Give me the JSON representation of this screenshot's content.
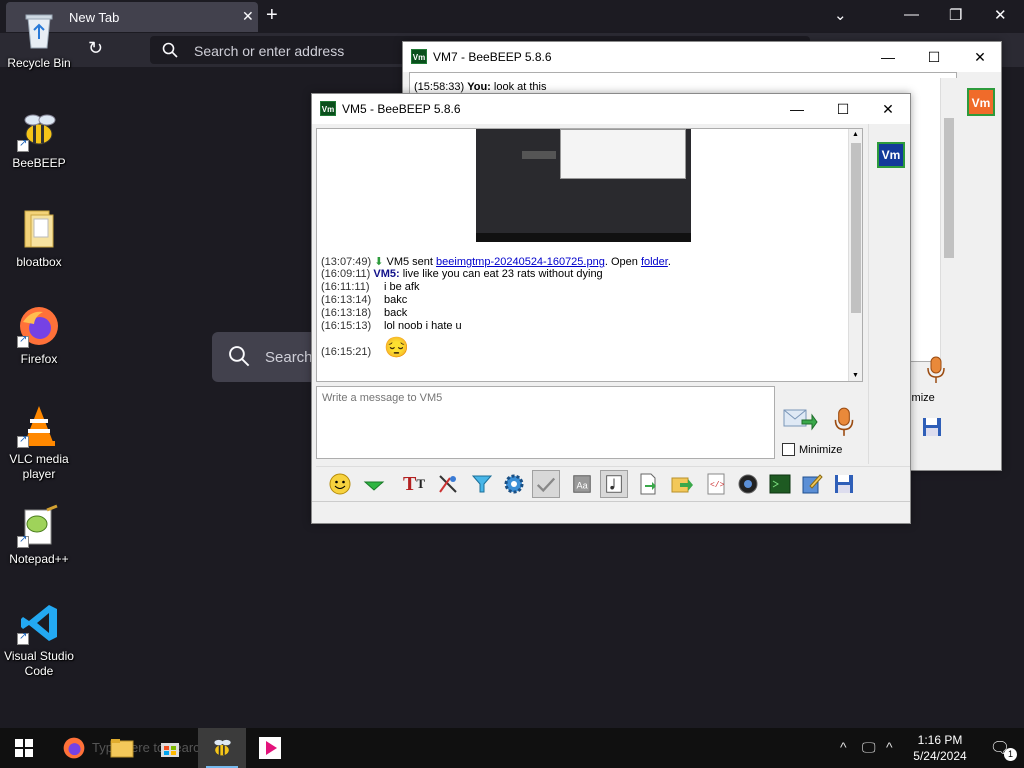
{
  "firefox": {
    "tab_title": "New Tab",
    "address_placeholder": "Search or enter address",
    "search_placeholder": "Search"
  },
  "desktop": {
    "icons": [
      {
        "label": "Recycle Bin"
      },
      {
        "label": "BeeBEEP"
      },
      {
        "label": "bloatbox"
      },
      {
        "label": "Firefox"
      },
      {
        "label": "VLC media player"
      },
      {
        "label": "Notepad++"
      },
      {
        "label": "Visual Studio Code"
      }
    ]
  },
  "vm7": {
    "title": "VM7 - BeeBEEP 5.8.6",
    "logo": "Vm",
    "peek_line": {
      "time": "(15:58:33)",
      "who": "You:",
      "text": "look at this"
    },
    "minimize_label": "nimize"
  },
  "vm5": {
    "title": "VM5 - BeeBEEP 5.8.6",
    "logo": "Vm",
    "file_line": {
      "time": "(13:07:49)",
      "prefix": "VM5 sent",
      "file": "beeimgtmp-20240524-160725.png",
      "middle": ". Open",
      "folder": "folder",
      "suffix": "."
    },
    "messages": [
      {
        "time": "(16:09:11)",
        "who": "VM5:",
        "text": "live like you can eat 23 rats without dying"
      },
      {
        "time": "(16:11:11)",
        "text": "i be afk"
      },
      {
        "time": "(16:13:14)",
        "text": "bakc"
      },
      {
        "time": "(16:13:18)",
        "text": "back"
      },
      {
        "time": "(16:15:13)",
        "text": "lol noob i hate u"
      },
      {
        "time": "(16:15:21)",
        "emoji": "😔"
      }
    ],
    "input_placeholder": "Write a message to VM5",
    "minimize_label": "Minimize"
  },
  "taskbar": {
    "search_text": "Type here to search",
    "time": "1:16 PM",
    "date": "5/24/2024",
    "notification_count": "1"
  },
  "colors": {
    "firefox_bg": "#1c1b22",
    "vm_badge_green": "#0a4f1c",
    "vm7_badge": "#f06b2a",
    "vm5_badge": "#123a9a",
    "link": "#0000cc"
  }
}
